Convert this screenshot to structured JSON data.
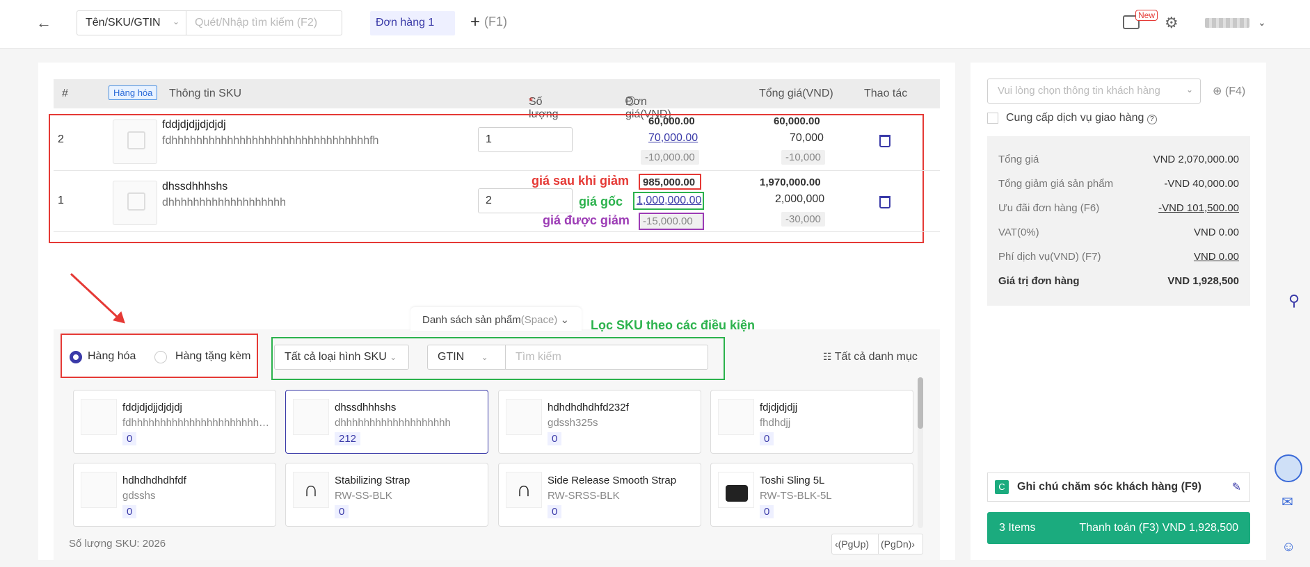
{
  "topbar": {
    "search_type": "Tên/SKU/GTIN",
    "search_placeholder": "Quét/Nhập tìm kiếm (F2)",
    "order_tab": "Đơn hàng 1",
    "add_tab_hint": "(F1)",
    "new_badge": "New"
  },
  "cart": {
    "headers": {
      "index": "#",
      "hanghoa_badge": "Hàng hóa",
      "sku_info": "Thông tin SKU",
      "quantity": "Số lượng",
      "required": "*",
      "unit_price": "Đơn giá(VND)",
      "total_price": "Tổng giá(VND)",
      "action": "Thao tác"
    },
    "rows": [
      {
        "index": "2",
        "name": "fddjdjdjjdjdjdj",
        "desc": "fdhhhhhhhhhhhhhhhhhhhhhhhhhhhhhhhhfh",
        "qty": "1",
        "unit_final": "60,000.00",
        "unit_original": "70,000.00",
        "unit_discount": "-10,000.00",
        "total_final": "60,000.00",
        "total_original": "70,000",
        "total_discount": "-10,000"
      },
      {
        "index": "1",
        "name": "dhssdhhhshs",
        "desc": "dhhhhhhhhhhhhhhhhhhh",
        "qty": "2",
        "unit_final": "985,000.00",
        "unit_original": "1,000,000.00",
        "unit_discount": "-15,000.00",
        "total_final": "1,970,000.00",
        "total_original": "2,000,000",
        "total_discount": "-30,000"
      }
    ]
  },
  "annotations": {
    "after_discount": "giá sau khi giảm",
    "original": "giá gốc",
    "discount": "giá được giảm",
    "filter": "Lọc SKU theo các điều kiện"
  },
  "product_list": {
    "tab_label": "Danh sách sản phẩm",
    "tab_hint": "(Space)",
    "radio_goods": "Hàng hóa",
    "radio_gift": "Hàng tặng kèm",
    "sku_type": "Tất cả loại hình SKU",
    "code_type": "GTIN",
    "search_placeholder": "Tìm kiếm",
    "all_categories": "Tất cả danh mục",
    "sku_count": "Số lượng SKU: 2026",
    "pg_up": "(PgUp)",
    "pg_dn": "(PgDn)",
    "items": [
      {
        "name": "fddjdjdjjdjdjdj",
        "code": "fdhhhhhhhhhhhhhhhhhhhhhhhhhhhhhhhhfh",
        "qty": "0"
      },
      {
        "name": "dhssdhhhshs",
        "code": "dhhhhhhhhhhhhhhhhhhh",
        "qty": "212"
      },
      {
        "name": "hdhdhdhdhfd232f",
        "code": "gdssh325s",
        "qty": "0"
      },
      {
        "name": "fdjdjdjdjj",
        "code": "fhdhdjj",
        "qty": "0"
      },
      {
        "name": "hdhdhdhdhfdf",
        "code": "gdsshs",
        "qty": "0"
      },
      {
        "name": "Stabilizing Strap",
        "code": "RW-SS-BLK",
        "qty": "0"
      },
      {
        "name": "Side Release Smooth Strap",
        "code": "RW-SRSS-BLK",
        "qty": "0"
      },
      {
        "name": "Toshi Sling 5L",
        "code": "RW-TS-BLK-5L",
        "qty": "0"
      }
    ]
  },
  "side": {
    "customer_placeholder": "Vui lòng chọn thông tin khách hàng",
    "customer_hint": "(F4)",
    "delivery": "Cung cấp dịch vụ giao hàng",
    "summary": [
      {
        "label": "Tổng giá",
        "value": "VND 2,070,000.00"
      },
      {
        "label": "Tổng giảm giá sản phẩm",
        "value": "-VND 40,000.00"
      },
      {
        "label": "Ưu đãi đơn hàng (F6)",
        "value": "-VND 101,500.00"
      },
      {
        "label": "VAT(0%)",
        "value": "VND 0.00"
      },
      {
        "label": "Phí dịch vụ(VND) (F7)",
        "value": "VND 0.00"
      },
      {
        "label": "Giá trị đơn hàng",
        "value": "VND 1,928,500"
      }
    ],
    "note_badge": "C",
    "note_label": "Ghi chú chăm sóc khách hàng (F9)",
    "pay_items": "3 Items",
    "pay_label": "Thanh toán (F3) VND 1,928,500"
  }
}
